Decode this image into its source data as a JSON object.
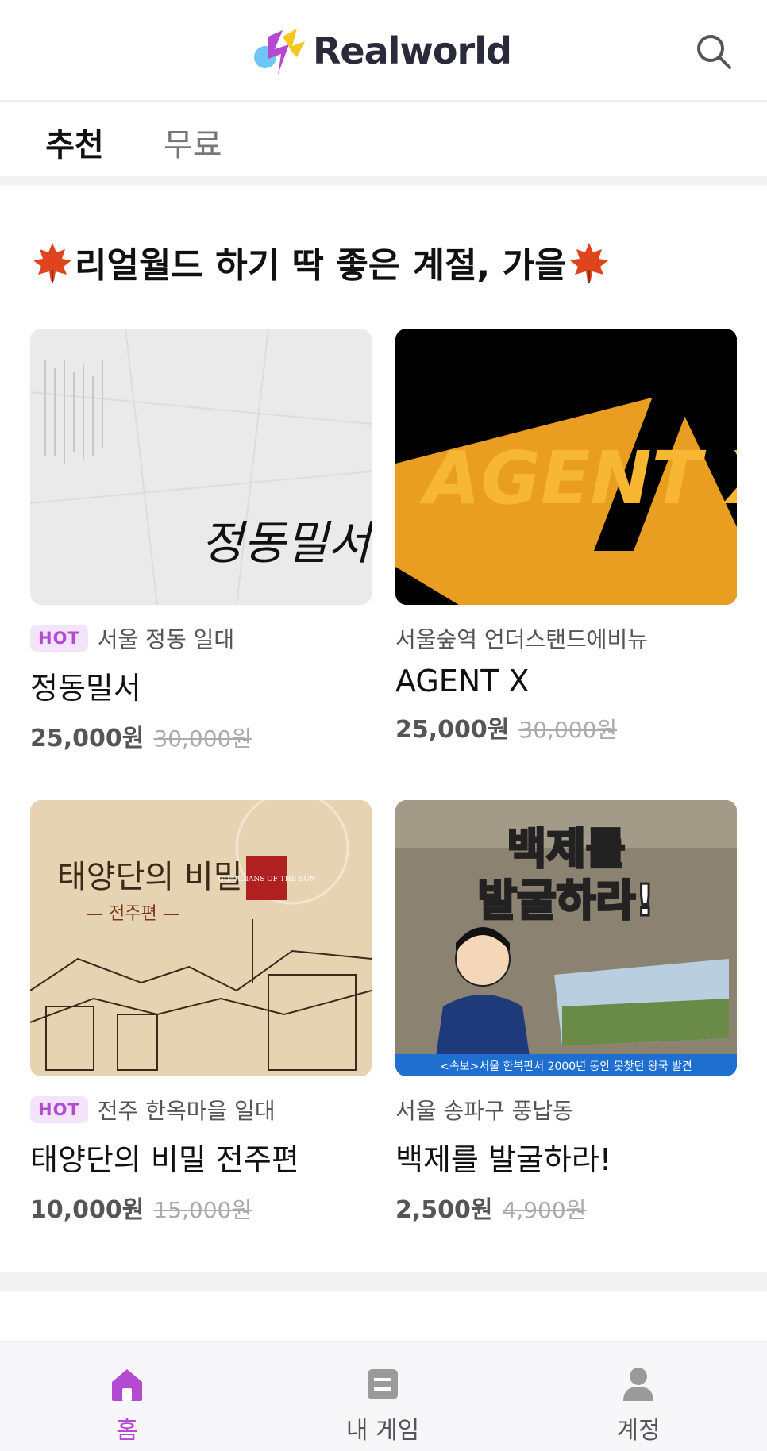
{
  "header": {
    "logo_text": "Realworld",
    "search_icon": "search-icon"
  },
  "tabs": [
    {
      "label": "추천",
      "active": true
    },
    {
      "label": "무료",
      "active": false
    }
  ],
  "section": {
    "title": "리얼월드 하기 딱 좋은 계절, 가을",
    "decoration_icon": "maple-leaf-icon"
  },
  "games": [
    {
      "badge": "HOT",
      "location": "서울 정동 일대",
      "title": "정동밀서",
      "price": "25,000원",
      "original_price": "30,000원",
      "thumb_text": "정동밀서"
    },
    {
      "badge": "",
      "location": "서울숲역 언더스탠드에비뉴",
      "title": "AGENT X",
      "price": "25,000원",
      "original_price": "30,000원",
      "thumb_text": "AGENT X"
    },
    {
      "badge": "HOT",
      "location": "전주 한옥마을 일대",
      "title": "태양단의 비밀 전주편",
      "price": "10,000원",
      "original_price": "15,000원",
      "thumb_text": "태양단의 비밀",
      "thumb_subtext": "— 전주편 —",
      "thumb_seal": "GUARDIANS OF THE SUN"
    },
    {
      "badge": "",
      "location": "서울 송파구 풍납동",
      "title": "백제를 발굴하라!",
      "price": "2,500원",
      "original_price": "4,900원",
      "thumb_text_1": "백제를",
      "thumb_text_2": "발굴하라!",
      "thumb_caption": "<속보>서울 한복판서 2000년 동안 못찾던 왕국 발견"
    }
  ],
  "bottom_nav": [
    {
      "label": "홈",
      "icon": "home-icon",
      "active": true
    },
    {
      "label": "내 게임",
      "icon": "my-game-icon",
      "active": false
    },
    {
      "label": "계정",
      "icon": "account-icon",
      "active": false
    }
  ],
  "colors": {
    "accent": "#b44ad1",
    "hot_bg": "#f4e4fb",
    "text_primary": "#111111",
    "text_secondary": "#555555",
    "agent_x_orange": "#f5a623"
  }
}
